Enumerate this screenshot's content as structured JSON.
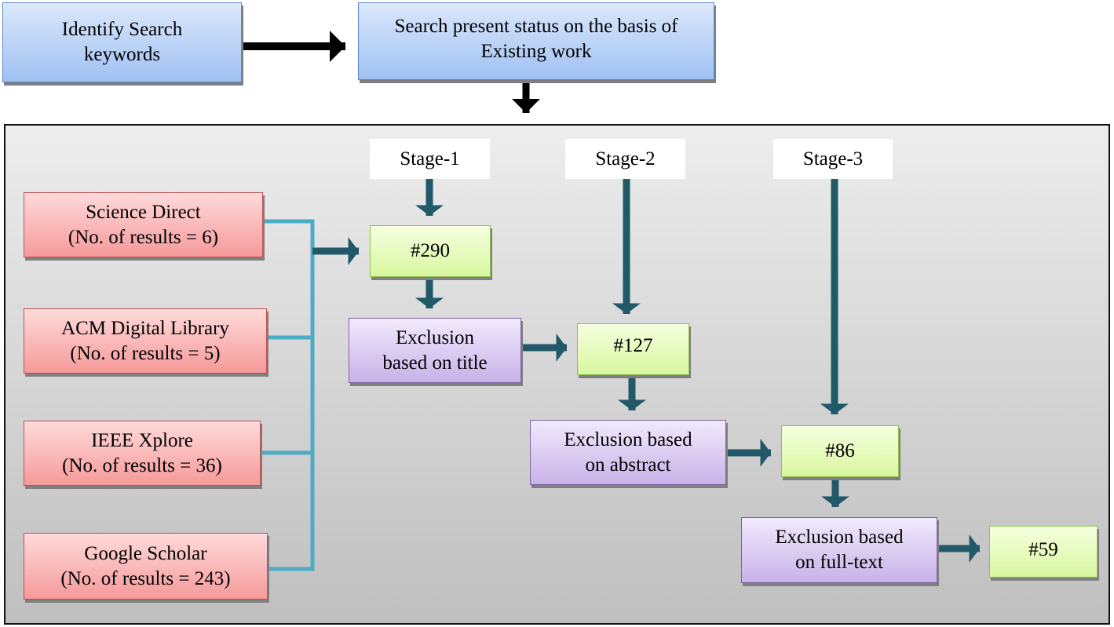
{
  "top": {
    "identify": [
      "Identify Search",
      "keywords"
    ],
    "search": [
      "Search present status on the basis of",
      "Existing work"
    ]
  },
  "stages": [
    "Stage-1",
    "Stage-2",
    "Stage-3"
  ],
  "sources": [
    {
      "name": "Science Direct",
      "results": "(No. of results = 6)"
    },
    {
      "name": "ACM Digital Library",
      "results": "(No. of results = 5)"
    },
    {
      "name": "IEEE Xplore",
      "results": "(No. of results = 36)"
    },
    {
      "name": "Google Scholar",
      "results": "(No. of results = 243)"
    }
  ],
  "counts": [
    "#290",
    "#127",
    "#86",
    "#59"
  ],
  "exclusions": [
    [
      "Exclusion",
      "based on title"
    ],
    [
      "Exclusion based",
      "on abstract"
    ],
    [
      "Exclusion based",
      "on full-text"
    ]
  ],
  "colors": {
    "blue": "#9fc1f3",
    "red": "#f59a9a",
    "green": "#d8f7a0",
    "purple": "#c8b2e8",
    "connector": "#4bacc6",
    "arrow": "#215968"
  }
}
